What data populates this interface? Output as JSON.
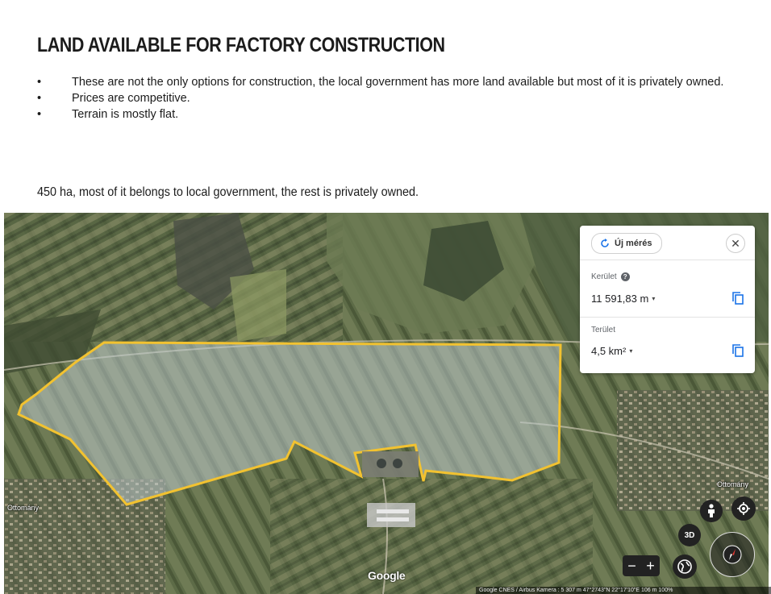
{
  "page": {
    "title": "LAND AVAILABLE FOR FACTORY CONSTRUCTION",
    "bullets": [
      "These are not the only options for construction, the local government has more land available but most of it is privately owned.",
      "Prices are competitive.",
      "Terrain is mostly flat."
    ],
    "bullet_marker": "•",
    "caption": "450 ha, most of it belongs to local government, the rest is privately owned."
  },
  "measure_panel": {
    "new_measurement_label": "Új mérés",
    "close_label": "✕",
    "perimeter_label": "Kerület",
    "help_label": "?",
    "perimeter_value": "11 591,83 m",
    "area_label": "Terület",
    "area_value": "4,5 km²",
    "dropdown_caret": "▾"
  },
  "map": {
    "town_labels": [
      "Ottomány",
      "Ottomány"
    ],
    "zoom_minus": "−",
    "zoom_plus": "+",
    "view_3d": "3D",
    "logo": "Google",
    "attribution": "Google CNES / Airbus   Kamera : 5 307 m  47°2743\"N 22°17'10\"E   106 m   100%",
    "polygon_color": "#f2c230",
    "icons": [
      "refresh-icon",
      "close-icon",
      "help-icon",
      "copy-icon",
      "pegman-icon",
      "location-icon",
      "globe-icon",
      "compass-icon"
    ]
  }
}
